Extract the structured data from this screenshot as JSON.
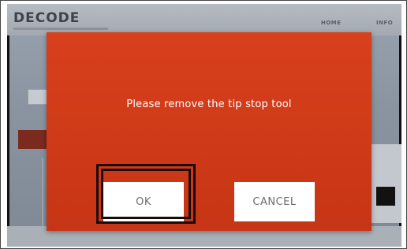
{
  "app": {
    "logo": "DECODE",
    "nav": {
      "home": "HOME",
      "info": "INFO"
    }
  },
  "dialog": {
    "message": "Please remove the tip stop tool",
    "ok_label": "OK",
    "cancel_label": "CANCEL",
    "color": "#d23c1a"
  }
}
